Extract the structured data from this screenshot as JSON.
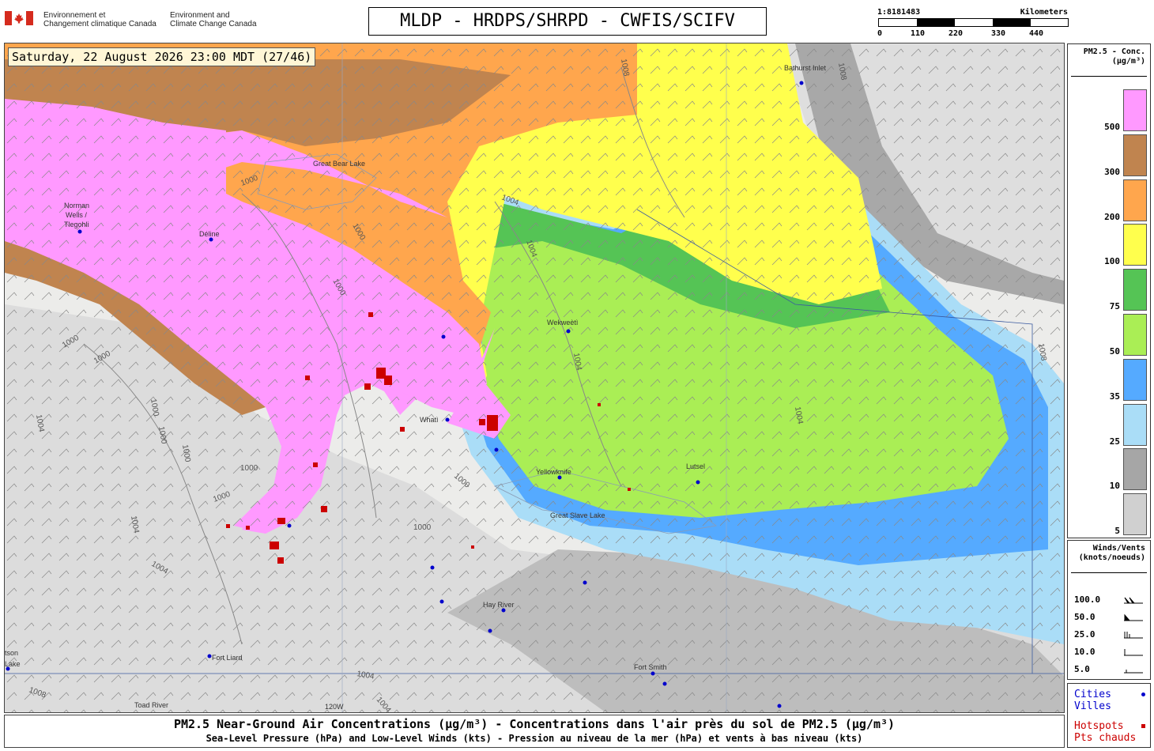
{
  "header": {
    "gov_fr_line1": "Environnement et",
    "gov_fr_line2": "Changement climatique Canada",
    "gov_en_line1": "Environment and",
    "gov_en_line2": "Climate Change Canada",
    "title": "MLDP - HRDPS/SHRPD - CWFIS/SCIFV"
  },
  "scale": {
    "ratio": "1:8181483",
    "unit": "Kilometers",
    "ticks": [
      "0",
      "110",
      "220",
      "330",
      "440"
    ]
  },
  "map": {
    "timestamp": "Saturday, 22 August 2026 23:00 MDT (27/46)",
    "places": [
      {
        "name": "Norman"
      },
      {
        "name": "Wells /"
      },
      {
        "name": "Tlegohli"
      },
      {
        "name": "Déline"
      },
      {
        "name": "Wekweètì"
      },
      {
        "name": "Whatì"
      },
      {
        "name": "Yellowknife"
      },
      {
        "name": "Lutsel"
      },
      {
        "name": "Hay River"
      },
      {
        "name": "Fort Liard"
      },
      {
        "name": "Fort Smith"
      },
      {
        "name": "Toad River"
      },
      {
        "name": "Bathurst Inlet"
      },
      {
        "name": "Great Bear Lake"
      },
      {
        "name": "Great Slave Lake"
      },
      {
        "name": "tson"
      },
      {
        "name": "Lake"
      },
      {
        "name": "120W"
      }
    ],
    "isobar_labels": [
      "1000",
      "1004",
      "1008"
    ]
  },
  "legend_pm": {
    "title_line1": "PM2.5 - Conc.",
    "title_line2": "(µg/m³)",
    "bins": [
      {
        "label": "500",
        "color": "#ff99ff"
      },
      {
        "label": "300",
        "color": "#c0844f"
      },
      {
        "label": "200",
        "color": "#ffa64d"
      },
      {
        "label": "100",
        "color": "#ffff4d"
      },
      {
        "label": "75",
        "color": "#55c455"
      },
      {
        "label": "50",
        "color": "#aaee55"
      },
      {
        "label": "35",
        "color": "#55aaff"
      },
      {
        "label": "25",
        "color": "#aaddf7"
      },
      {
        "label": "10",
        "color": "#a6a6a6"
      },
      {
        "label": "5",
        "color": "#d0d0d0"
      }
    ]
  },
  "legend_wind": {
    "title_line1": "Winds/Vents",
    "title_line2": "(knots/noeuds)",
    "rows": [
      "100.0",
      "50.0",
      "25.0",
      "10.0",
      "5.0"
    ]
  },
  "legend_points": {
    "cities_en": "Cities",
    "cities_fr": "Villes",
    "hotspots_en": "Hotspots",
    "hotspots_fr": "Pts chauds",
    "city_color": "#0000cc",
    "hotspot_color": "#cc0000"
  },
  "footer": {
    "line1": "PM2.5 Near-Ground Air Concentrations (µg/m³) - Concentrations dans l'air près du sol de PM2.5 (µg/m³)",
    "line2": "Sea-Level Pressure (hPa) and Low-Level Winds (kts) - Pression au niveau de la mer (hPa) et vents à bas niveau (kts)"
  }
}
